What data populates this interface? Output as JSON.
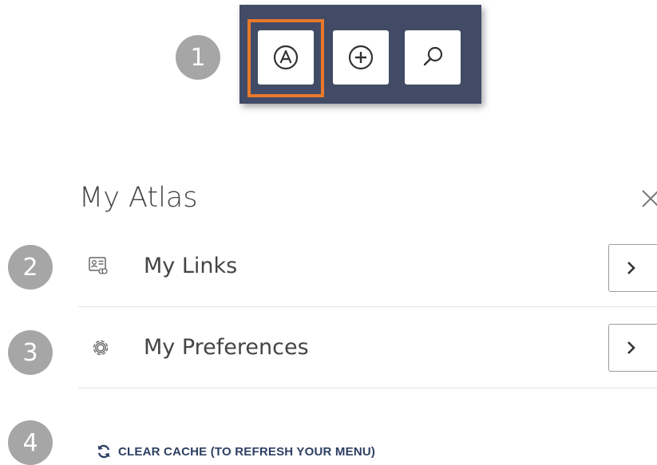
{
  "badges": [
    "1",
    "2",
    "3",
    "4"
  ],
  "toolbar": {
    "buttons": [
      {
        "icon": "atlas-a-icon"
      },
      {
        "icon": "plus-circle-icon"
      },
      {
        "icon": "search-icon"
      }
    ]
  },
  "panel": {
    "title": "My Atlas",
    "items": [
      {
        "label": "My Links",
        "icon": "links-card-icon"
      },
      {
        "label": "My Preferences",
        "icon": "gear-icon"
      }
    ],
    "clear_cache": "CLEAR CACHE (TO REFRESH YOUR MENU)"
  },
  "colors": {
    "toolbar_bg": "#414b66",
    "highlight": "#e8782b",
    "badge": "#a6a6a6",
    "link": "#2d3f62"
  }
}
